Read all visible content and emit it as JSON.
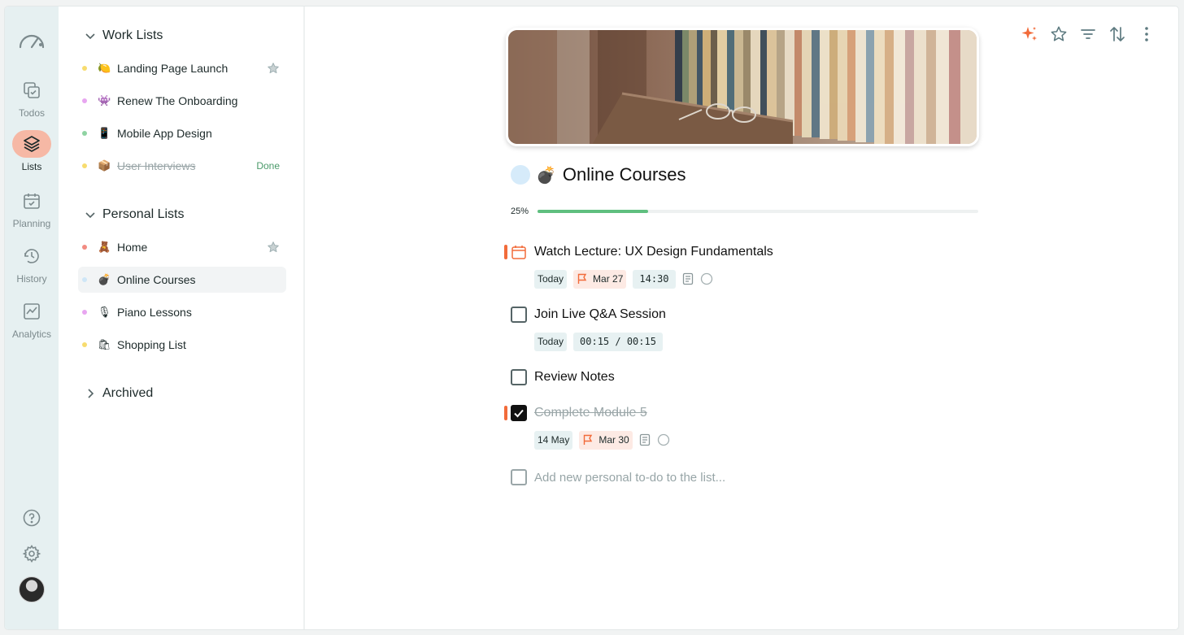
{
  "rail": {
    "items": [
      {
        "label": "Todos"
      },
      {
        "label": "Lists"
      },
      {
        "label": "Planning"
      },
      {
        "label": "History"
      },
      {
        "label": "Analytics"
      }
    ]
  },
  "sidebar": {
    "work_title": "Work Lists",
    "work_items": [
      {
        "name": "Landing Page Launch",
        "emoji": "🍋",
        "dot": "#f7dc6f",
        "starred": true
      },
      {
        "name": "Renew The Onboarding",
        "emoji": "👾",
        "dot": "#e8a6f0"
      },
      {
        "name": "Mobile App Design",
        "emoji": "📱",
        "dot": "#8fd3a2"
      },
      {
        "name": "User Interviews",
        "emoji": "📦",
        "dot": "#f7dc6f",
        "done_label": "Done"
      }
    ],
    "personal_title": "Personal Lists",
    "personal_items": [
      {
        "name": "Home",
        "emoji": "🧸",
        "dot": "#f28b82",
        "starred": true
      },
      {
        "name": "Online Courses",
        "emoji": "💣",
        "dot": "#cfe6f7",
        "selected": true
      },
      {
        "name": "Piano Lessons",
        "emoji": "🎙",
        "dot": "#e8a6f0"
      },
      {
        "name": "Shopping List",
        "emoji": "🛍",
        "dot": "#f7dc6f"
      }
    ],
    "archived_title": "Archived"
  },
  "main": {
    "title": "Online Courses",
    "title_emoji": "💣",
    "progress": 0.25,
    "progress_label": "25%",
    "tasks": [
      {
        "name": "Watch Lecture: UX Design Fundamentals",
        "date": "Today",
        "flag": "Mar 27",
        "time": "14:30"
      },
      {
        "name": "Join Live Q&A Session",
        "date": "Today",
        "timer": "00:15 / 00:15"
      },
      {
        "name": "Review Notes"
      },
      {
        "name": "Complete Module 5",
        "date": "14 May",
        "flag": "Mar 30",
        "done": true
      }
    ],
    "new_placeholder": "Add new personal to-do to the list..."
  },
  "colors": {
    "accent": "#f26b3a",
    "progress": "#5fbf7f",
    "rail_bg": "#e6f0f1",
    "active_pill": "#f6b8a5"
  }
}
